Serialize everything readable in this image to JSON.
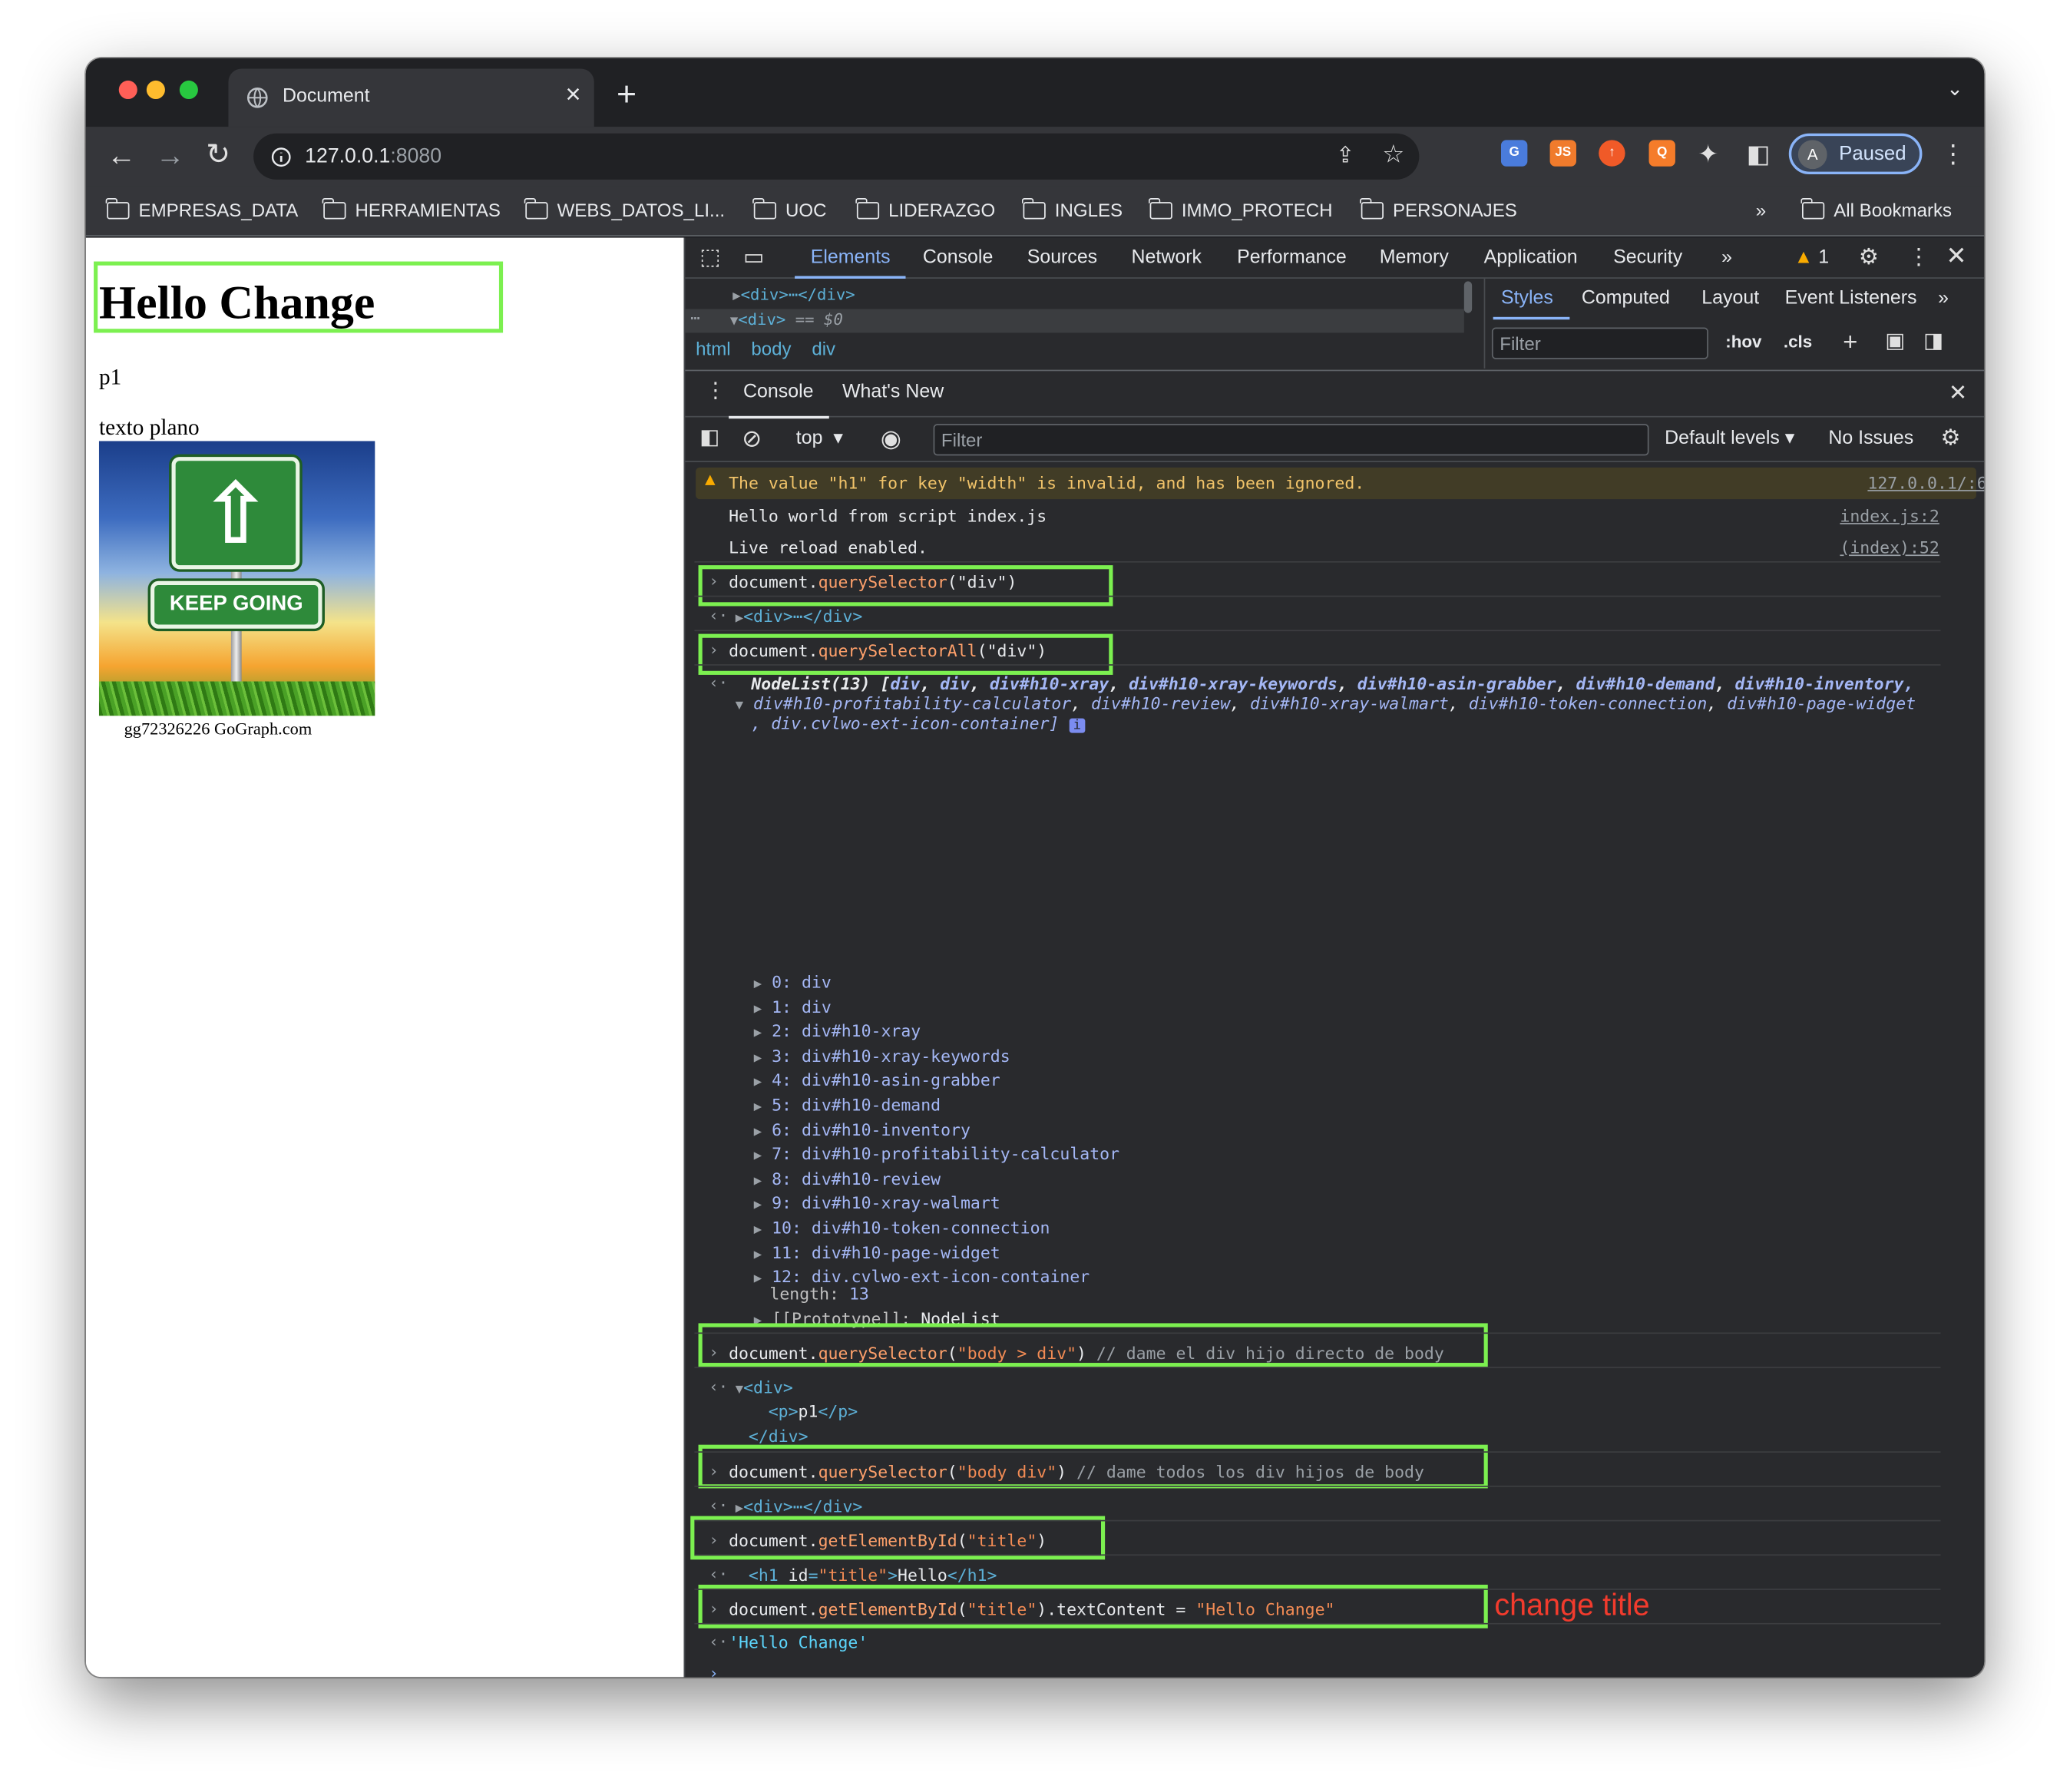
{
  "tab_title": "Document",
  "url_host": "127.0.0.1",
  "url_port": ":8080",
  "paused_label": "Paused",
  "avatar_letter": "A",
  "bookmarks": [
    "EMPRESAS_DATA",
    "HERRAMIENTAS",
    "WEBS_DATOS_LI...",
    "UOC",
    "LIDERAZGO",
    "INGLES",
    "IMMO_PROTECH",
    "PERSONAJES"
  ],
  "all_bookmarks": "All Bookmarks",
  "page": {
    "h1": "Hello Change",
    "p1": "p1",
    "text": "texto plano",
    "sign": "KEEP GOING",
    "credit": "gg72326226 GoGraph.com"
  },
  "devtools": {
    "tabs": [
      "Elements",
      "Console",
      "Sources",
      "Network",
      "Performance",
      "Memory",
      "Application",
      "Security"
    ],
    "warn_count": "1",
    "dom_line1": "<div>⋯</div>",
    "dom_line2": "<div>",
    "dom_eq": "== $0",
    "crumbs": [
      "html",
      "body",
      "div"
    ],
    "side_tabs": [
      "Styles",
      "Computed",
      "Layout",
      "Event Listeners"
    ],
    "filter": "Filter",
    "hov": ":hov",
    "cls": ".cls",
    "drawer_tabs": [
      "Console",
      "What's New"
    ],
    "context": "top",
    "default_levels": "Default levels ▾",
    "no_issues": "No Issues"
  },
  "console": {
    "warning": "The value \"h1\" for key \"width\" is invalid, and has been ignored.",
    "warning_src": "127.0.0.1/:6",
    "log1": "Hello world from script index.js",
    "log1_src": "index.js:2",
    "log2": "Live reload enabled.",
    "log2_src": "(index):52",
    "cmd1": [
      "document.",
      "querySelector",
      "(\"div\")"
    ],
    "res1": "<div>⋯</div>",
    "cmd2": [
      "document.",
      "querySelectorAll",
      "(\"div\")"
    ],
    "nodelist_head": "NodeList(13) [",
    "nodelist_items1": [
      "div",
      "div",
      "div#h10-xray",
      "div#h10-xray-keywords",
      "div#h10-asin-grabber",
      "div#h10-demand",
      "div#h10-inventory,"
    ],
    "nodelist_items2": [
      "div#h10-profitability-calculator",
      "div#h10-review",
      "div#h10-xray-walmart",
      "div#h10-token-connection",
      "div#h10-page-widget"
    ],
    "nodelist_items3": ", div.cvlwo-ext-icon-container]",
    "entries": [
      [
        "0",
        "div"
      ],
      [
        "1",
        "div"
      ],
      [
        "2",
        "div#h10-xray"
      ],
      [
        "3",
        "div#h10-xray-keywords"
      ],
      [
        "4",
        "div#h10-asin-grabber"
      ],
      [
        "5",
        "div#h10-demand"
      ],
      [
        "6",
        "div#h10-inventory"
      ],
      [
        "7",
        "div#h10-profitability-calculator"
      ],
      [
        "8",
        "div#h10-review"
      ],
      [
        "9",
        "div#h10-xray-walmart"
      ],
      [
        "10",
        "div#h10-token-connection"
      ],
      [
        "11",
        "div#h10-page-widget"
      ],
      [
        "12",
        "div.cvlwo-ext-icon-container"
      ]
    ],
    "length_label": "length:",
    "length_val": "13",
    "proto_label": "[[Prototype]]:",
    "proto_val": "NodeList",
    "cmd3": [
      "document.",
      "querySelector",
      "(\"body > div\")",
      " // dame el div hijo directo de body"
    ],
    "res3a": "<div>",
    "res3b": "<p>p1</p>",
    "res3c": "</div>",
    "cmd4": [
      "document.",
      "querySelector",
      "(\"body div\")",
      " // dame todos los div hijos de body"
    ],
    "res4": "<div>⋯</div>",
    "cmd5": [
      "document.",
      "getElementById",
      "(\"title\")"
    ],
    "res5": "<h1 id=\"title\">Hello</h1>",
    "cmd6": [
      "document.",
      "getElementById",
      "(\"title\").textContent = \"Hello Change\""
    ],
    "res6": "'Hello Change'",
    "annotation": "change title"
  }
}
